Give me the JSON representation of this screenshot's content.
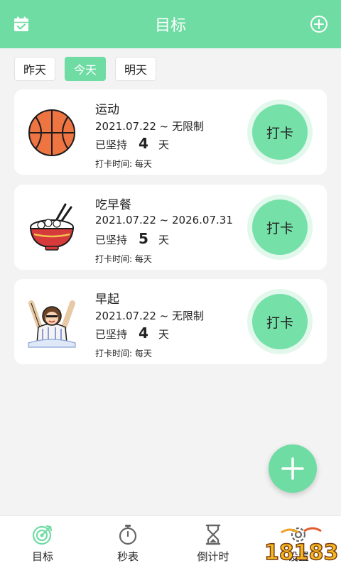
{
  "header": {
    "title": "目标",
    "calendar_icon": "calendar-check-icon",
    "add_icon": "plus-circle-icon"
  },
  "day_tabs": [
    {
      "label": "昨天",
      "active": false
    },
    {
      "label": "今天",
      "active": true
    },
    {
      "label": "明天",
      "active": false
    }
  ],
  "goals": [
    {
      "name": "运动",
      "dates": "2021.07.22 ~ 无限制",
      "persist_prefix": "已坚持",
      "days": "4",
      "persist_suffix": "天",
      "freq": "打卡时间:  每天",
      "button": "打卡",
      "icon": "basketball-icon"
    },
    {
      "name": "吃早餐",
      "dates": "2021.07.22 ~ 2026.07.31",
      "persist_prefix": "已坚持",
      "days": "5",
      "persist_suffix": "天",
      "freq": "打卡时间:  每天",
      "button": "打卡",
      "icon": "rice-bowl-icon"
    },
    {
      "name": "早起",
      "dates": "2021.07.22 ~ 无限制",
      "persist_prefix": "已坚持",
      "days": "4",
      "persist_suffix": "天",
      "freq": "打卡时间:  每天",
      "button": "打卡",
      "icon": "waking-person-icon"
    }
  ],
  "fab_icon": "plus-icon",
  "tabbar": [
    {
      "label": "目标",
      "icon": "target-icon",
      "active": true
    },
    {
      "label": "秒表",
      "icon": "stopwatch-icon",
      "active": false
    },
    {
      "label": "倒计时",
      "icon": "hourglass-icon",
      "active": false
    },
    {
      "label": "设置",
      "icon": "gear-icon",
      "active": false
    }
  ],
  "watermark": "18183",
  "colors": {
    "accent": "#6fdca4",
    "punch": "#75e0a8",
    "background": "#f2f3f2"
  }
}
